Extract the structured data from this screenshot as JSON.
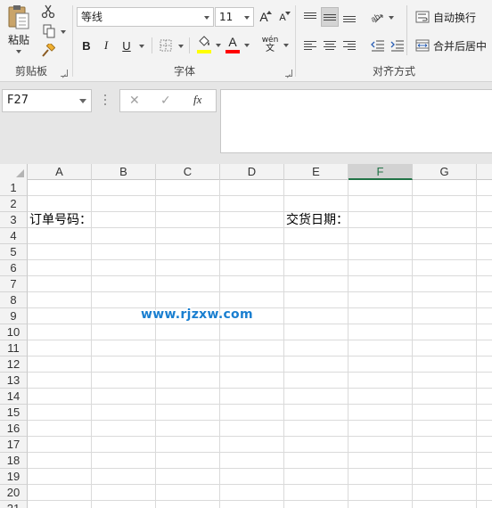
{
  "ribbon": {
    "clipboard": {
      "label": "剪贴板",
      "paste_label": "粘贴"
    },
    "font": {
      "label": "字体",
      "font_name": "等线",
      "font_size": "11",
      "grow_label": "A",
      "shrink_label": "A",
      "bold_label": "B",
      "italic_label": "I",
      "underline_label": "U",
      "font_color_label": "A",
      "fill_color": "#ffff00",
      "font_color": "#ff0000",
      "phonetic_top": "wén",
      "phonetic_bottom": "文"
    },
    "alignment": {
      "label": "对齐方式",
      "wrap_text_label": "自动换行",
      "merge_center_label": "合并后居中"
    }
  },
  "formula_bar": {
    "name_box": "F27",
    "cancel_label": "✕",
    "enter_label": "✓",
    "fx_label": "fx",
    "formula": ""
  },
  "sheet": {
    "columns": [
      "A",
      "B",
      "C",
      "D",
      "E",
      "F",
      "G"
    ],
    "active_column": "F",
    "rows": [
      "1",
      "2",
      "3",
      "4",
      "5",
      "6",
      "7",
      "8",
      "9",
      "10",
      "11",
      "12",
      "13",
      "14",
      "15",
      "16",
      "17",
      "18",
      "19",
      "20",
      "21"
    ],
    "cells": {
      "A3": "订单号码：",
      "E3": "交货日期："
    }
  },
  "watermark": "www.rjzxw.com",
  "colors": {
    "accent": "#217346",
    "watermark": "#1a7fd0"
  }
}
